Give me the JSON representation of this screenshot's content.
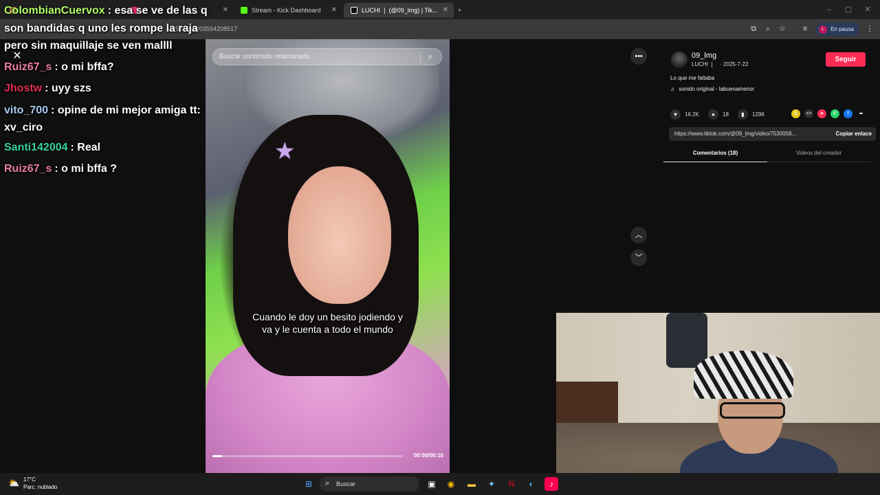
{
  "browser": {
    "tabs": [
      {
        "label": "",
        "icon": "tab-icon",
        "color": "#cc8844"
      },
      {
        "label": "",
        "icon": "tab-icon",
        "color": "#e1306c"
      },
      {
        "label": "Stream - Kick Dashboard",
        "icon": "kick-icon",
        "color": "#53fc18"
      },
      {
        "label": "LUCHI ❘ (@09_lmg) | Tik...",
        "icon": "tiktok-icon",
        "color": "#ffffff"
      }
    ],
    "url": "...5300589035942085 17",
    "url_text": "7530058903594208517",
    "profile_initial": "L",
    "profile_status": "En pausa"
  },
  "chat": [
    {
      "user": "ColombianCuervox",
      "user_color": "#b3ff6a",
      "message": ": esa se ve de las q"
    },
    {
      "user": "",
      "user_color": "#ffffff",
      "message": "son bandidas q uno les rompe la raja"
    },
    {
      "user": "",
      "user_color": "#ffffff",
      "message": "pero sin maquillaje se ven mallll"
    },
    {
      "user": "Ruiz67_s",
      "user_color": "#e87fa1",
      "message": ": o mi bffa?"
    },
    {
      "user": "Jhostw",
      "user_color": "#e03050",
      "message": ": uyy szs"
    },
    {
      "user": "vito_700",
      "user_color": "#a9c8ee",
      "message": ": opine de mi mejor amiga tt:"
    },
    {
      "user": "",
      "user_color": "#ffffff",
      "message": "xv_ciro"
    },
    {
      "user": "Santi142004",
      "user_color": "#39d39a",
      "message": ": Real"
    },
    {
      "user": "Ruiz67_s",
      "user_color": "#e87fa1",
      "message": ": o mi bffa ?"
    }
  ],
  "video": {
    "search_placeholder": "Buscar contenido relacionado",
    "caption": "Cuando le doy un besito jodiendo y va y le cuenta a todo el mundo",
    "time": "00:00/00:10",
    "progress": 0.05
  },
  "controls": {
    "more_label": "•••",
    "up_label": "︿",
    "down_label": "﹀",
    "close_label": "✕"
  },
  "author": {
    "username": "09_lmg",
    "display": "LUCHI ❘",
    "date": "· 2025-7-22",
    "follow_label": "Seguir",
    "description": "Lo que me faltaba",
    "sound": "sonido original - labuenamenor"
  },
  "stats": {
    "likes": "16.2K",
    "comments": "18",
    "saves": "1296"
  },
  "link": {
    "url": "https://www.tiktok.com/@09_lmg/video/7530058...",
    "copy_label": "Copiar enlace"
  },
  "panel_tabs": {
    "comments": "Comentarios (18)",
    "creator_videos": "Videos del creador"
  },
  "taskbar": {
    "temp": "17°C",
    "weather": "Parc. nublado",
    "search_label": "Buscar"
  },
  "colors": {
    "accent": "#fe2c55",
    "kick_green": "#53fc18"
  }
}
